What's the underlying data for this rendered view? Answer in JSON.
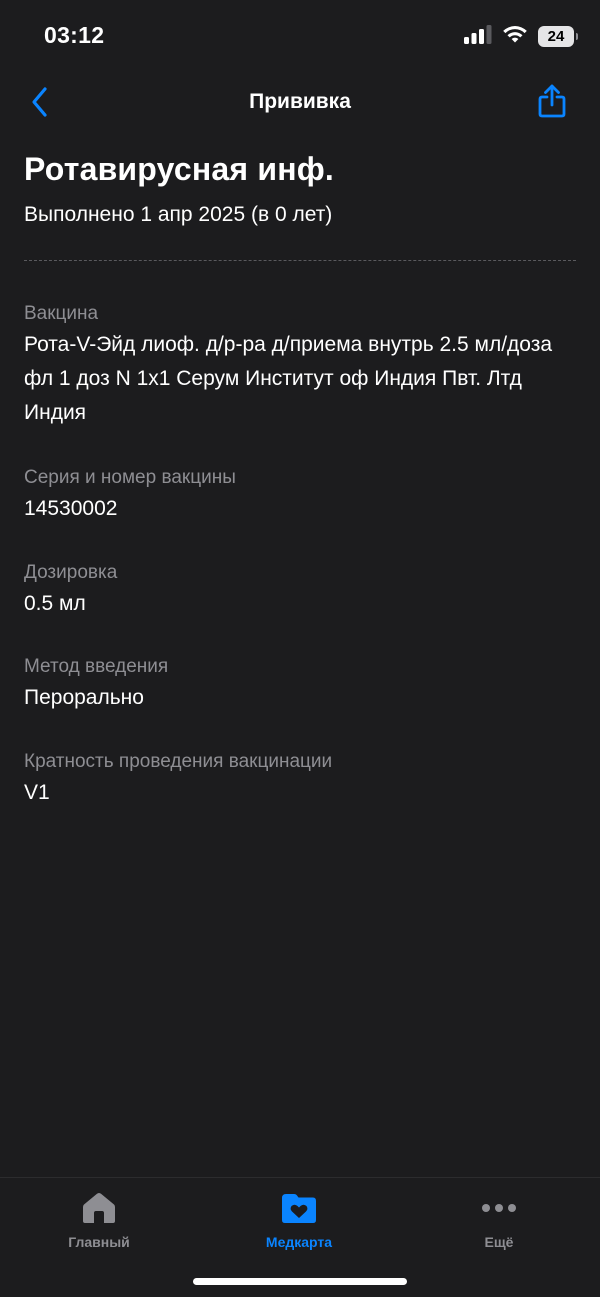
{
  "status_bar": {
    "time": "03:12",
    "battery": "24"
  },
  "nav": {
    "title": "Прививка",
    "accent": "#0a84ff"
  },
  "header": {
    "title": "Ротавирусная инф.",
    "subtitle": "Выполнено 1 апр 2025 (в 0 лет)"
  },
  "fields": [
    {
      "label": "Вакцина",
      "value": "Рота-V-Эйд лиоф. д/р-ра д/приема внутрь 2.5 мл/доза фл 1 доз N 1x1 Серум Институт оф Индия Пвт. Лтд Индия"
    },
    {
      "label": "Серия и номер вакцины",
      "value": "14530002"
    },
    {
      "label": "Дозировка",
      "value": "0.5 мл"
    },
    {
      "label": "Метод введения",
      "value": "Перорально"
    },
    {
      "label": "Кратность проведения вакцинации",
      "value": "V1"
    }
  ],
  "tab_bar": {
    "tabs": [
      {
        "label": "Главный",
        "icon": "house-icon",
        "active": false
      },
      {
        "label": "Медкарта",
        "icon": "heart-folder-icon",
        "active": true
      },
      {
        "label": "Ещё",
        "icon": "more-dots-icon",
        "active": false
      }
    ],
    "active_color": "#0a84ff",
    "inactive_color": "#8e8e93"
  }
}
